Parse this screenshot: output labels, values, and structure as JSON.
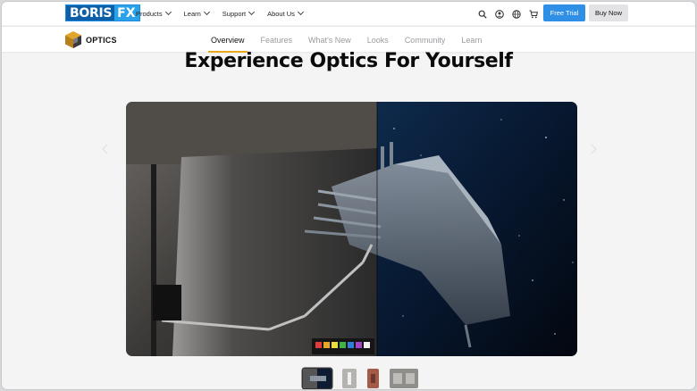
{
  "brand": {
    "logo_left": "BORIS",
    "logo_right": "FX"
  },
  "nav": {
    "menu": [
      {
        "label": "Products"
      },
      {
        "label": "Learn"
      },
      {
        "label": "Support"
      },
      {
        "label": "About Us"
      }
    ],
    "icons": [
      "search-icon",
      "account-icon",
      "globe-icon",
      "cart-icon"
    ],
    "free_trial": "Free Trial",
    "buy_now": "Buy Now"
  },
  "product": {
    "name": "OPTICS",
    "tabs": [
      {
        "label": "Overview",
        "active": true
      },
      {
        "label": "Features"
      },
      {
        "label": "What's New"
      },
      {
        "label": "Looks"
      },
      {
        "label": "Community"
      },
      {
        "label": "Learn"
      }
    ]
  },
  "hero": {
    "headline": "Experience Optics For Yourself"
  },
  "carousel": {
    "thumbnail_count": 4,
    "active_index": 0
  },
  "colors": {
    "accent_blue": "#2f8fe6",
    "tab_underline": "#e8a91e",
    "logo_dark": "#0d5fa8",
    "logo_light": "#2aa2ea"
  }
}
